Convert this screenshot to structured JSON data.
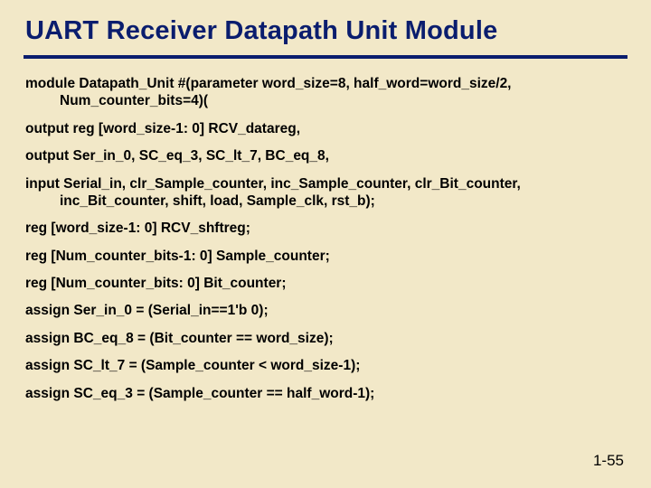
{
  "title": "UART Receiver Datapath Unit Module",
  "lines": {
    "l1a": "module Datapath_Unit #(parameter word_size=8, half_word=word_size/2,",
    "l1b": "Num_counter_bits=4)(",
    "l2": "output  reg [word_size-1: 0] RCV_datareg,",
    "l3": "output  Ser_in_0, SC_eq_3, SC_lt_7, BC_eq_8,",
    "l4a": "input  Serial_in, clr_Sample_counter, inc_Sample_counter,  clr_Bit_counter,",
    "l4b": "inc_Bit_counter, shift, load, Sample_clk, rst_b);",
    "l5": "reg  [word_size-1: 0]  RCV_shftreg;",
    "l6": "reg  [Num_counter_bits-1: 0]  Sample_counter;",
    "l7": "reg  [Num_counter_bits: 0]  Bit_counter;",
    "l8": "assign Ser_in_0 = (Serial_in==1'b 0);",
    "l9": "assign BC_eq_8 = (Bit_counter == word_size);",
    "l10": "assign SC_lt_7 = (Sample_counter < word_size-1);",
    "l11": "assign SC_eq_3 = (Sample_counter == half_word-1);"
  },
  "page_number": "1-55"
}
